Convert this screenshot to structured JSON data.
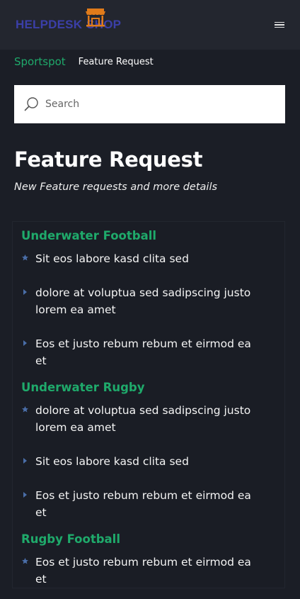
{
  "header": {
    "logo_left": "HELPDESK",
    "logo_right": "SHOP",
    "menu_icon": "hamburger-icon"
  },
  "breadcrumb": {
    "parent": "Sportspot",
    "current": "Feature Request"
  },
  "search": {
    "placeholder": "Search",
    "icon": "search-icon"
  },
  "page": {
    "title": "Feature Request",
    "subtitle": "New Feature requests and more details"
  },
  "colors": {
    "accent": "#1faa6b",
    "marker": "#4a6ea8",
    "logo": "#3b3fa8",
    "logo_shop": "#e07b1a"
  },
  "categories": [
    {
      "title": "Underwater Football",
      "items": [
        {
          "icon": "star-icon",
          "text": "Sit eos labore kasd clita sed"
        },
        {
          "icon": "triangle-right-icon",
          "text": "dolore at voluptua sed sadipscing justo lorem ea amet"
        },
        {
          "icon": "triangle-right-icon",
          "text": "Eos et justo rebum rebum et eirmod ea et"
        }
      ]
    },
    {
      "title": "Underwater Rugby",
      "items": [
        {
          "icon": "star-icon",
          "text": "dolore at voluptua sed sadipscing justo lorem ea amet"
        },
        {
          "icon": "triangle-right-icon",
          "text": "Sit eos labore kasd clita sed"
        },
        {
          "icon": "triangle-right-icon",
          "text": "Eos et justo rebum rebum et eirmod ea et"
        }
      ]
    },
    {
      "title": "Rugby Football",
      "items": [
        {
          "icon": "star-icon",
          "text": "Eos et justo rebum rebum et eirmod ea et"
        }
      ]
    }
  ]
}
